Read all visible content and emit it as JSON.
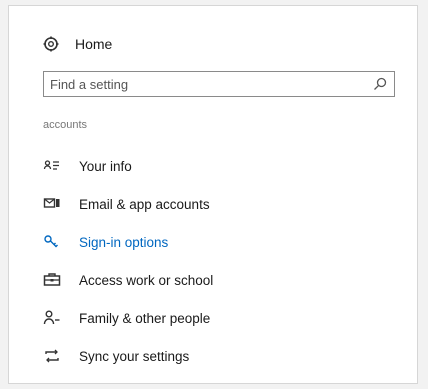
{
  "home": {
    "label": "Home",
    "icon": "home-gear-icon"
  },
  "search": {
    "placeholder": "Find a setting",
    "value": "",
    "icon": "search-icon"
  },
  "section": {
    "heading": "accounts"
  },
  "nav": {
    "items": [
      {
        "label": "Your info",
        "icon": "person-card-icon",
        "active": false
      },
      {
        "label": "Email & app accounts",
        "icon": "mail-icon",
        "active": false
      },
      {
        "label": "Sign-in options",
        "icon": "key-icon",
        "active": true
      },
      {
        "label": "Access work or school",
        "icon": "briefcase-icon",
        "active": false
      },
      {
        "label": "Family & other people",
        "icon": "person-add-icon",
        "active": false
      },
      {
        "label": "Sync your settings",
        "icon": "sync-icon",
        "active": false
      }
    ]
  },
  "colors": {
    "accent": "#0067c0",
    "text": "#1a1a1a",
    "muted": "#777777",
    "background": "#ffffff"
  }
}
